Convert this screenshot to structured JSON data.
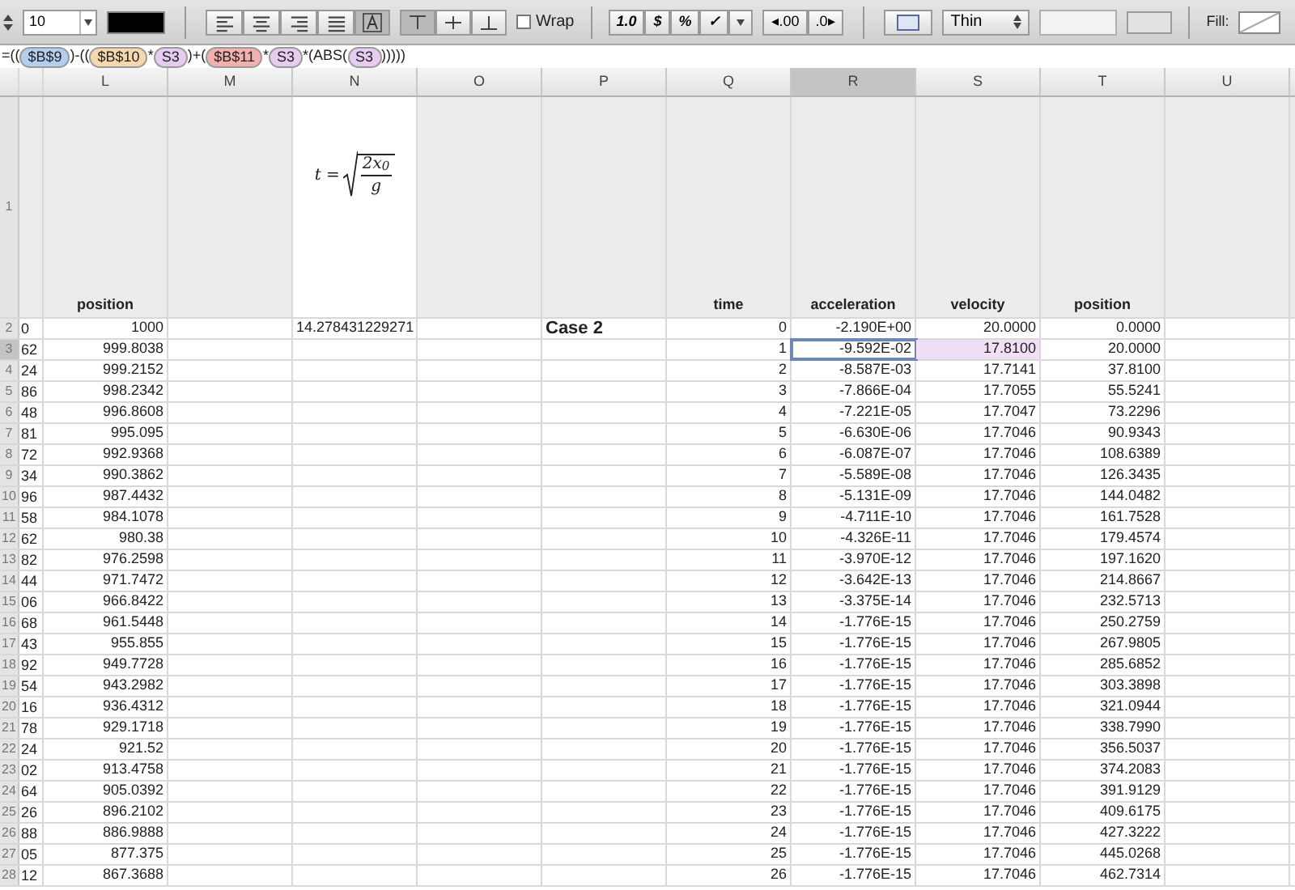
{
  "toolbar": {
    "font_size": "10",
    "horizontal_align": [
      {
        "selected": false
      },
      {
        "selected": false
      },
      {
        "selected": false
      },
      {
        "selected": false
      },
      {
        "selected": true
      }
    ],
    "vertical_align": [
      {
        "selected": true
      },
      {
        "selected": false
      },
      {
        "selected": false
      }
    ],
    "wrap": {
      "label": "Wrap",
      "checked": false
    },
    "number_buttons": [
      "1.0",
      "$",
      "%",
      "✓"
    ],
    "decimal_buttons": [
      "◂.00",
      ".0▸"
    ],
    "border_style": "Thin",
    "fill_label": "Fill:"
  },
  "formula": [
    {
      "kind": "text",
      "text": "=(("
    },
    {
      "kind": "ref",
      "text": "$B$9",
      "color": "#b5cdee"
    },
    {
      "kind": "text",
      "text": ")-(("
    },
    {
      "kind": "ref",
      "text": "$B$10",
      "color": "#f7d7ad"
    },
    {
      "kind": "text",
      "text": "*"
    },
    {
      "kind": "ref",
      "text": "S3",
      "color": "#e6cdf0"
    },
    {
      "kind": "text",
      "text": ")+("
    },
    {
      "kind": "ref",
      "text": "$B$11",
      "color": "#f2b0ae"
    },
    {
      "kind": "text",
      "text": "*"
    },
    {
      "kind": "ref",
      "text": "S3",
      "color": "#e6cdf0"
    },
    {
      "kind": "text",
      "text": "*(ABS("
    },
    {
      "kind": "ref",
      "text": "S3",
      "color": "#e6cdf0"
    },
    {
      "kind": "text",
      "text": ")))))"
    }
  ],
  "columns": [
    {
      "label": "L",
      "selected": false
    },
    {
      "label": "M",
      "selected": false
    },
    {
      "label": "N",
      "selected": false
    },
    {
      "label": "O",
      "selected": false
    },
    {
      "label": "P",
      "selected": false
    },
    {
      "label": "Q",
      "selected": false
    },
    {
      "label": "R",
      "selected": true
    },
    {
      "label": "S",
      "selected": false
    },
    {
      "label": "T",
      "selected": false
    },
    {
      "label": "U",
      "selected": false
    }
  ],
  "header_row": {
    "number": "1",
    "l": "position",
    "q": "time",
    "r": "acceleration",
    "s": "velocity",
    "t": "position",
    "equation": {
      "lhs": "t =",
      "numerator": "2x$_{0}$",
      "denominator": "g"
    }
  },
  "rows": [
    {
      "number": "2",
      "selected": false,
      "referenced": false,
      "k": "0",
      "l": "1000",
      "n": "14.278431229271",
      "p": "Case 2",
      "q": "0",
      "r": "-2.190E+00",
      "s": "20.0000",
      "t": "0.0000"
    },
    {
      "number": "3",
      "selected": true,
      "referenced": true,
      "k": "62",
      "l": "999.8038",
      "q": "1",
      "r": "-9.592E-02",
      "s": "17.8100",
      "t": "20.0000"
    },
    {
      "number": "4",
      "selected": false,
      "referenced": false,
      "k": "24",
      "l": "999.2152",
      "q": "2",
      "r": "-8.587E-03",
      "s": "17.7141",
      "t": "37.8100"
    },
    {
      "number": "5",
      "selected": false,
      "referenced": false,
      "k": "86",
      "l": "998.2342",
      "q": "3",
      "r": "-7.866E-04",
      "s": "17.7055",
      "t": "55.5241"
    },
    {
      "number": "6",
      "selected": false,
      "referenced": false,
      "k": "48",
      "l": "996.8608",
      "q": "4",
      "r": "-7.221E-05",
      "s": "17.7047",
      "t": "73.2296"
    },
    {
      "number": "7",
      "selected": false,
      "referenced": false,
      "k": "81",
      "l": "995.095",
      "q": "5",
      "r": "-6.630E-06",
      "s": "17.7046",
      "t": "90.9343"
    },
    {
      "number": "8",
      "selected": false,
      "referenced": false,
      "k": "72",
      "l": "992.9368",
      "q": "6",
      "r": "-6.087E-07",
      "s": "17.7046",
      "t": "108.6389"
    },
    {
      "number": "9",
      "selected": false,
      "referenced": false,
      "k": "34",
      "l": "990.3862",
      "q": "7",
      "r": "-5.589E-08",
      "s": "17.7046",
      "t": "126.3435"
    },
    {
      "number": "10",
      "selected": false,
      "referenced": false,
      "k": "96",
      "l": "987.4432",
      "q": "8",
      "r": "-5.131E-09",
      "s": "17.7046",
      "t": "144.0482"
    },
    {
      "number": "11",
      "selected": false,
      "referenced": false,
      "k": "58",
      "l": "984.1078",
      "q": "9",
      "r": "-4.711E-10",
      "s": "17.7046",
      "t": "161.7528"
    },
    {
      "number": "12",
      "selected": false,
      "referenced": false,
      "k": "62",
      "l": "980.38",
      "q": "10",
      "r": "-4.326E-11",
      "s": "17.7046",
      "t": "179.4574"
    },
    {
      "number": "13",
      "selected": false,
      "referenced": false,
      "k": "82",
      "l": "976.2598",
      "q": "11",
      "r": "-3.970E-12",
      "s": "17.7046",
      "t": "197.1620"
    },
    {
      "number": "14",
      "selected": false,
      "referenced": false,
      "k": "44",
      "l": "971.7472",
      "q": "12",
      "r": "-3.642E-13",
      "s": "17.7046",
      "t": "214.8667"
    },
    {
      "number": "15",
      "selected": false,
      "referenced": false,
      "k": "06",
      "l": "966.8422",
      "q": "13",
      "r": "-3.375E-14",
      "s": "17.7046",
      "t": "232.5713"
    },
    {
      "number": "16",
      "selected": false,
      "referenced": false,
      "k": "68",
      "l": "961.5448",
      "q": "14",
      "r": "-1.776E-15",
      "s": "17.7046",
      "t": "250.2759"
    },
    {
      "number": "17",
      "selected": false,
      "referenced": false,
      "k": "43",
      "l": "955.855",
      "q": "15",
      "r": "-1.776E-15",
      "s": "17.7046",
      "t": "267.9805"
    },
    {
      "number": "18",
      "selected": false,
      "referenced": false,
      "k": "92",
      "l": "949.7728",
      "q": "16",
      "r": "-1.776E-15",
      "s": "17.7046",
      "t": "285.6852"
    },
    {
      "number": "19",
      "selected": false,
      "referenced": false,
      "k": "54",
      "l": "943.2982",
      "q": "17",
      "r": "-1.776E-15",
      "s": "17.7046",
      "t": "303.3898"
    },
    {
      "number": "20",
      "selected": false,
      "referenced": false,
      "k": "16",
      "l": "936.4312",
      "q": "18",
      "r": "-1.776E-15",
      "s": "17.7046",
      "t": "321.0944"
    },
    {
      "number": "21",
      "selected": false,
      "referenced": false,
      "k": "78",
      "l": "929.1718",
      "q": "19",
      "r": "-1.776E-15",
      "s": "17.7046",
      "t": "338.7990"
    },
    {
      "number": "22",
      "selected": false,
      "referenced": false,
      "k": "24",
      "l": "921.52",
      "q": "20",
      "r": "-1.776E-15",
      "s": "17.7046",
      "t": "356.5037"
    },
    {
      "number": "23",
      "selected": false,
      "referenced": false,
      "k": "02",
      "l": "913.4758",
      "q": "21",
      "r": "-1.776E-15",
      "s": "17.7046",
      "t": "374.2083"
    },
    {
      "number": "24",
      "selected": false,
      "referenced": false,
      "k": "64",
      "l": "905.0392",
      "q": "22",
      "r": "-1.776E-15",
      "s": "17.7046",
      "t": "391.9129"
    },
    {
      "number": "25",
      "selected": false,
      "referenced": false,
      "k": "26",
      "l": "896.2102",
      "q": "23",
      "r": "-1.776E-15",
      "s": "17.7046",
      "t": "409.6175"
    },
    {
      "number": "26",
      "selected": false,
      "referenced": false,
      "k": "88",
      "l": "886.9888",
      "q": "24",
      "r": "-1.776E-15",
      "s": "17.7046",
      "t": "427.3222"
    },
    {
      "number": "27",
      "selected": false,
      "referenced": false,
      "k": "05",
      "l": "877.375",
      "q": "25",
      "r": "-1.776E-15",
      "s": "17.7046",
      "t": "445.0268"
    },
    {
      "number": "28",
      "selected": false,
      "referenced": false,
      "k": "12",
      "l": "867.3688",
      "q": "26",
      "r": "-1.776E-15",
      "s": "17.7046",
      "t": "462.7314"
    }
  ]
}
